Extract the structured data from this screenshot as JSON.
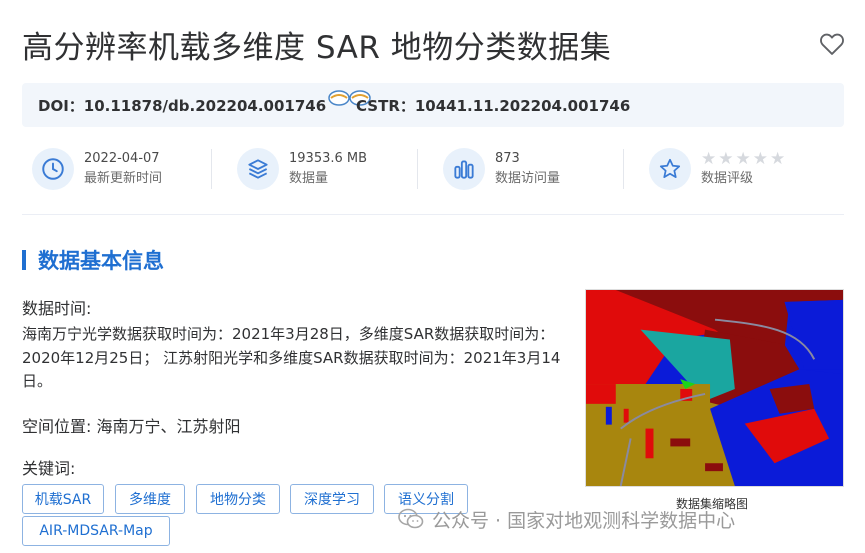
{
  "dataset": {
    "title": "高分辨率机载多维度 SAR 地物分类数据集",
    "doi": "DOI：10.11878/db.202204.001746",
    "cstr": "CSTR：10441.11.202204.001746"
  },
  "stats": [
    {
      "value": "2022-04-07",
      "label": "最新更新时间",
      "icon": "clock-icon"
    },
    {
      "value": "19353.6 MB",
      "label": "数据量",
      "icon": "layers-icon"
    },
    {
      "value": "873",
      "label": "数据访问量",
      "icon": "bar-chart-icon"
    },
    {
      "value": "",
      "label": "数据评级",
      "icon": "star-icon",
      "rating": 0,
      "max_rating": 5
    }
  ],
  "section": {
    "title": "数据基本信息"
  },
  "info": {
    "time_label": "数据时间:",
    "time_text": "海南万宁光学数据获取时间为：2021年3月28日，多维度SAR数据获取时间为：2020年12月25日； 江苏射阳光学和多维度SAR数据获取时间为：2021年3月14日。",
    "location_label": "空间位置:",
    "location_value": "海南万宁、江苏射阳",
    "keywords_label": "关键词:"
  },
  "keywords": [
    "机载SAR",
    "多维度",
    "地物分类",
    "深度学习",
    "语义分割",
    "AIR-MDSAR-Map"
  ],
  "thumbnail": {
    "caption": "数据集缩略图"
  },
  "watermark": {
    "text": "公众号 · 国家对地观测科学数据中心"
  },
  "colors": {
    "accent": "#1f6fd1",
    "doi_bg": "#f2f6fb",
    "icon_circle": "#e8f1fb",
    "tag_border": "#8db3e2"
  }
}
